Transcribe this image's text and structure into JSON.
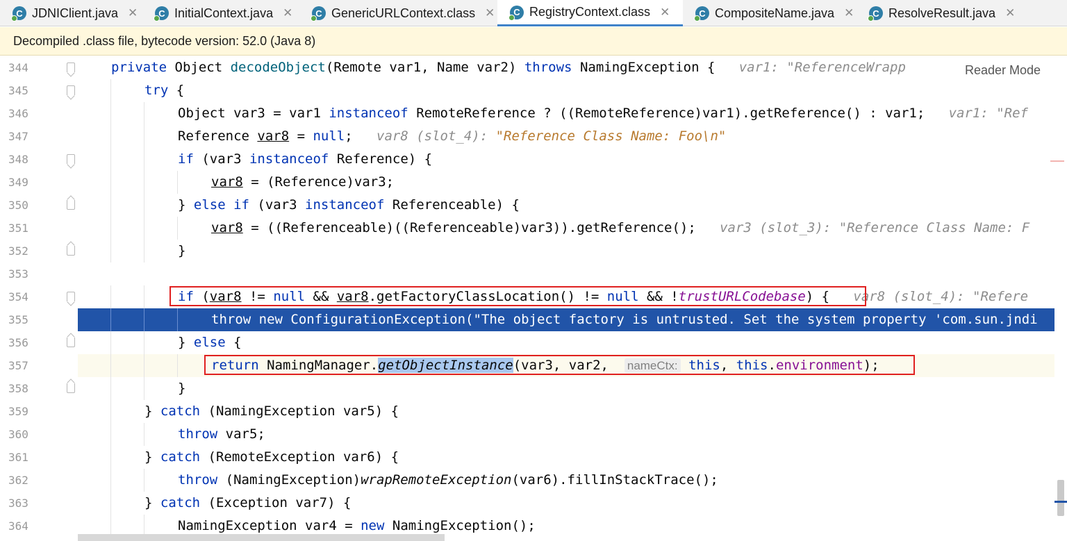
{
  "tabs": [
    {
      "label": "JDNIClient.java",
      "icon": "java-class-icon",
      "active": false
    },
    {
      "label": "InitialContext.java",
      "icon": "java-class-icon",
      "active": false
    },
    {
      "label": "GenericURLContext.class",
      "icon": "java-class-icon",
      "active": false
    },
    {
      "label": "RegistryContext.class",
      "icon": "java-class-icon",
      "active": true
    },
    {
      "label": "CompositeName.java",
      "icon": "java-class-icon",
      "active": false
    },
    {
      "label": "ResolveResult.java",
      "icon": "java-class-icon",
      "active": false
    }
  ],
  "tab_close_glyph": "✕",
  "banner": {
    "text": "Decompiled .class file, bytecode version: 52.0 (Java 8)"
  },
  "reader_mode": "Reader Mode",
  "editor": {
    "executing_line": "355",
    "caret_line": "357",
    "lines": [
      {
        "num": "344",
        "fold": "open",
        "indent": 1,
        "segments": [
          {
            "t": "private ",
            "c": "kw"
          },
          {
            "t": "Object "
          },
          {
            "t": "decodeObject",
            "c": "fn"
          },
          {
            "t": "(Remote var1, Name var2) "
          },
          {
            "t": "throws ",
            "c": "kw"
          },
          {
            "t": "NamingException {   "
          },
          {
            "t": "var1: \"ReferenceWrapp",
            "c": "hint"
          }
        ]
      },
      {
        "num": "345",
        "fold": "open",
        "indent": 2,
        "segments": [
          {
            "t": "try ",
            "c": "kw"
          },
          {
            "t": "{"
          }
        ]
      },
      {
        "num": "346",
        "fold": "",
        "indent": 3,
        "segments": [
          {
            "t": "Object var3 = var1 "
          },
          {
            "t": "instanceof ",
            "c": "kw"
          },
          {
            "t": "RemoteReference ? ((RemoteReference)var1).getReference() : var1;   "
          },
          {
            "t": "var1: \"Ref",
            "c": "hint"
          }
        ]
      },
      {
        "num": "347",
        "fold": "",
        "indent": 3,
        "segments": [
          {
            "t": "Reference "
          },
          {
            "t": "var8",
            "c": "ul"
          },
          {
            "t": " = "
          },
          {
            "t": "null",
            "c": "kw"
          },
          {
            "t": ";   "
          },
          {
            "t": "var8 (slot_4): ",
            "c": "hint"
          },
          {
            "t": "\"Reference Class Name: Foo\\n\"",
            "c": "hstr"
          }
        ]
      },
      {
        "num": "348",
        "fold": "open",
        "indent": 3,
        "segments": [
          {
            "t": "if ",
            "c": "kw"
          },
          {
            "t": "(var3 "
          },
          {
            "t": "instanceof ",
            "c": "kw"
          },
          {
            "t": "Reference) {"
          }
        ]
      },
      {
        "num": "349",
        "fold": "",
        "indent": 4,
        "segments": [
          {
            "t": "var8",
            "c": "ul"
          },
          {
            "t": " = (Reference)var3;"
          }
        ]
      },
      {
        "num": "350",
        "fold": "close",
        "indent": 3,
        "segments": [
          {
            "t": "} "
          },
          {
            "t": "else if ",
            "c": "kw"
          },
          {
            "t": "(var3 "
          },
          {
            "t": "instanceof ",
            "c": "kw"
          },
          {
            "t": "Referenceable) {"
          }
        ]
      },
      {
        "num": "351",
        "fold": "",
        "indent": 4,
        "segments": [
          {
            "t": "var8",
            "c": "ul"
          },
          {
            "t": " = ((Referenceable)((Referenceable)var3)).getReference();   "
          },
          {
            "t": "var3 (slot_3): \"Reference Class Name: F",
            "c": "hint"
          }
        ]
      },
      {
        "num": "352",
        "fold": "close",
        "indent": 3,
        "segments": [
          {
            "t": "}"
          }
        ]
      },
      {
        "num": "353",
        "fold": "",
        "indent": 0,
        "segments": []
      },
      {
        "num": "354",
        "fold": "open",
        "indent": 3,
        "segments": [
          {
            "t": "if ",
            "c": "kw"
          },
          {
            "t": "("
          },
          {
            "t": "var8",
            "c": "ul"
          },
          {
            "t": " != "
          },
          {
            "t": "null ",
            "c": "kw"
          },
          {
            "t": "&& "
          },
          {
            "t": "var8",
            "c": "ul"
          },
          {
            "t": ".getFactoryClassLocation() != "
          },
          {
            "t": "null ",
            "c": "kw"
          },
          {
            "t": "&& !"
          },
          {
            "t": "trustURLCodebase",
            "c": "static"
          },
          {
            "t": ") {   "
          },
          {
            "t": "var8 (slot_4): \"Refere",
            "c": "hint"
          }
        ]
      },
      {
        "num": "355",
        "fold": "",
        "indent": 4,
        "segments": [
          {
            "t": "throw new ConfigurationException(\"The object factory is untrusted. Set the system property 'com.sun.jndi"
          }
        ]
      },
      {
        "num": "356",
        "fold": "close",
        "indent": 3,
        "segments": [
          {
            "t": "} "
          },
          {
            "t": "else ",
            "c": "kw"
          },
          {
            "t": "{"
          }
        ]
      },
      {
        "num": "357",
        "fold": "",
        "indent": 4,
        "segments": [
          {
            "t": "return ",
            "c": "kw"
          },
          {
            "t": "NamingManager."
          },
          {
            "t": "getObjectInstance",
            "c": "ital sel"
          },
          {
            "t": "(var3, var2,  "
          },
          {
            "t": "nameCtx:",
            "c": "pbadge"
          },
          {
            "t": " "
          },
          {
            "t": "this",
            "c": "kw"
          },
          {
            "t": ", "
          },
          {
            "t": "this",
            "c": "kw"
          },
          {
            "t": "."
          },
          {
            "t": "environment",
            "c": "fieldc"
          },
          {
            "t": ");"
          }
        ]
      },
      {
        "num": "358",
        "fold": "close",
        "indent": 3,
        "segments": [
          {
            "t": "}"
          }
        ]
      },
      {
        "num": "359",
        "fold": "",
        "indent": 2,
        "segments": [
          {
            "t": "} "
          },
          {
            "t": "catch ",
            "c": "kw"
          },
          {
            "t": "(NamingException var5) {"
          }
        ]
      },
      {
        "num": "360",
        "fold": "",
        "indent": 3,
        "segments": [
          {
            "t": "throw ",
            "c": "kw"
          },
          {
            "t": "var5;"
          }
        ]
      },
      {
        "num": "361",
        "fold": "",
        "indent": 2,
        "segments": [
          {
            "t": "} "
          },
          {
            "t": "catch ",
            "c": "kw"
          },
          {
            "t": "(RemoteException var6) {"
          }
        ]
      },
      {
        "num": "362",
        "fold": "",
        "indent": 3,
        "segments": [
          {
            "t": "throw ",
            "c": "kw"
          },
          {
            "t": "(NamingException)"
          },
          {
            "t": "wrapRemoteException",
            "c": "ital"
          },
          {
            "t": "(var6).fillInStackTrace();"
          }
        ]
      },
      {
        "num": "363",
        "fold": "",
        "indent": 2,
        "segments": [
          {
            "t": "} "
          },
          {
            "t": "catch ",
            "c": "kw"
          },
          {
            "t": "(Exception var7) {"
          }
        ]
      },
      {
        "num": "364",
        "fold": "",
        "indent": 3,
        "segments": [
          {
            "t": "NamingException var4 = "
          },
          {
            "t": "new ",
            "c": "kw"
          },
          {
            "t": "NamingException();"
          }
        ]
      }
    ]
  },
  "annotations": [
    {
      "label": "red-box-line-354"
    },
    {
      "label": "red-box-line-357"
    }
  ]
}
